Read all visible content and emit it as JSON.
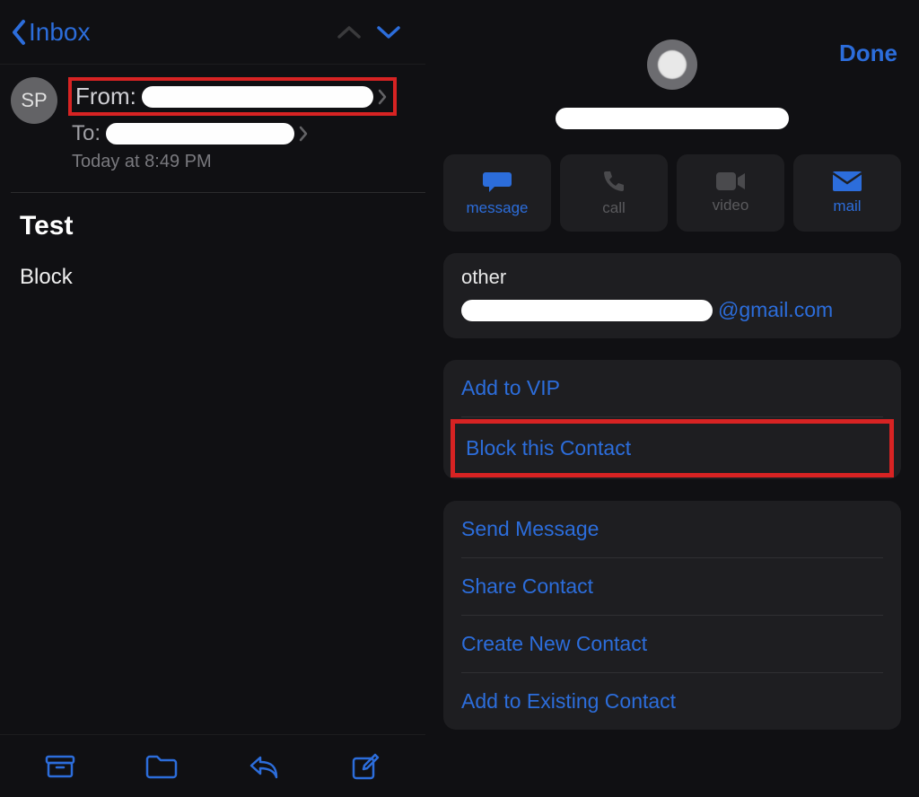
{
  "left": {
    "back_label": "Inbox",
    "avatar_initials": "SP",
    "from_label": "From:",
    "to_label": "To:",
    "date_line": "Today at 8:49 PM",
    "subject": "Test",
    "body": "Block"
  },
  "right": {
    "done_label": "Done",
    "actions": {
      "message": "message",
      "call": "call",
      "video": "video",
      "mail": "mail"
    },
    "email_section_label": "other",
    "email_suffix": "@gmail.com",
    "vip_card": {
      "add_vip": "Add to VIP",
      "block": "Block this Contact"
    },
    "contact_card": {
      "send_msg": "Send Message",
      "share": "Share Contact",
      "create": "Create New Contact",
      "add_existing": "Add to Existing Contact"
    }
  }
}
